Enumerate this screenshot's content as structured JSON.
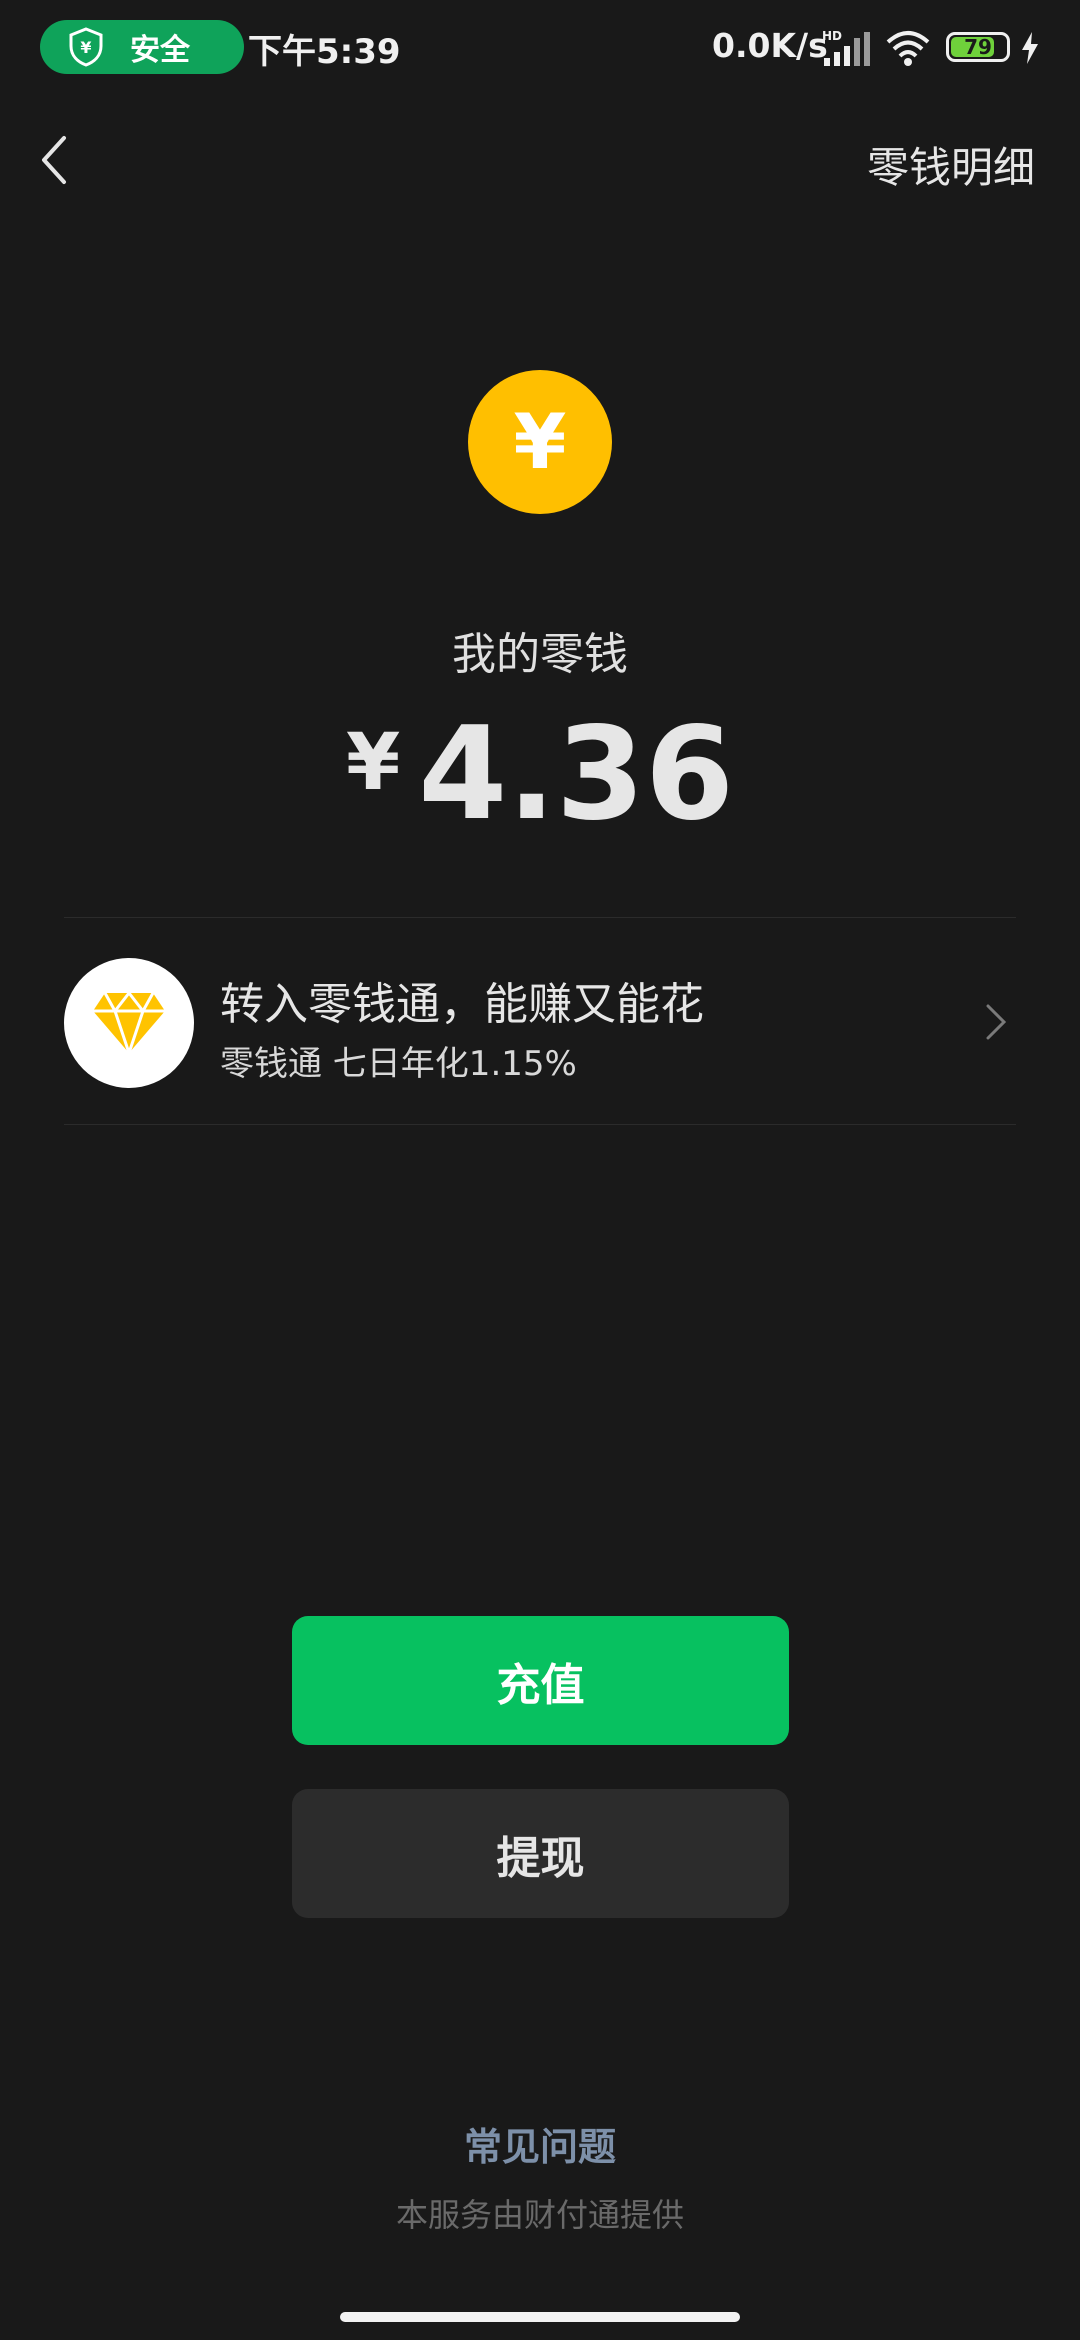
{
  "status_bar": {
    "safe_label": "安全",
    "time": "下午5:39",
    "net_speed": "0.0K/s",
    "battery_level": "79",
    "battery_fraction": 0.79
  },
  "nav": {
    "detail_link": "零钱明细"
  },
  "coin_symbol": "¥",
  "balance": {
    "label": "我的零钱",
    "currency": "¥",
    "amount": "4.36"
  },
  "promo": {
    "title": "转入零钱通，能赚又能花",
    "subtitle": "零钱通 七日年化1.15%"
  },
  "buttons": {
    "topup": "充值",
    "withdraw": "提现"
  },
  "footer": {
    "faq": "常见问题",
    "provider": "本服务由财付通提供"
  },
  "colors": {
    "background": "#191919",
    "primary_green": "#07c160",
    "coin_yellow": "#ffbf00",
    "safe_green": "#0fa35a",
    "faq_blue": "#7d90a9"
  },
  "icons": [
    "shield-yuan-icon",
    "signal-icon",
    "wifi-icon",
    "battery-icon",
    "bolt-icon",
    "back-arrow-icon",
    "yuan-coin-icon",
    "diamond-icon",
    "chevron-right-icon"
  ]
}
